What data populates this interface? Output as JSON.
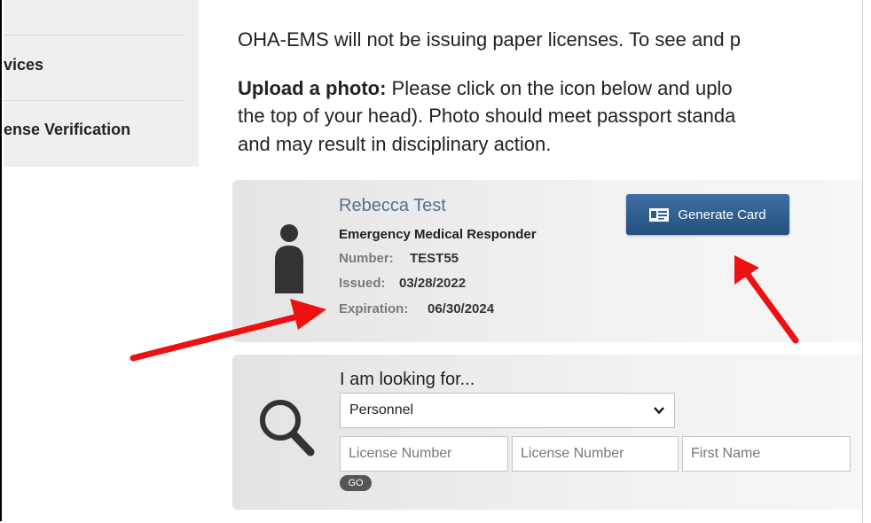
{
  "sidebar": {
    "items": [
      {
        "label": "vices"
      },
      {
        "label": "ense Verification"
      }
    ]
  },
  "main": {
    "intro": "OHA-EMS will not be issuing paper licenses. To see and p",
    "upload_bold": "Upload a photo:",
    "upload_line1": " Please click on the icon below and uplo",
    "upload_line2": "the top of your head). Photo should meet passport standa",
    "upload_line3": "and may result in disciplinary action."
  },
  "license": {
    "name": "Rebecca Test",
    "certification": "Emergency Medical Responder",
    "number_label": "Number:",
    "number_value": "TEST55",
    "issued_label": "Issued:",
    "issued_value": "03/28/2022",
    "expiration_label": "Expiration:",
    "expiration_value": "06/30/2024",
    "generate_button": "Generate Card"
  },
  "search": {
    "looking_label": "I am looking for...",
    "selected_type": "Personnel",
    "field1_placeholder": "License Number",
    "field2_placeholder": "License Number",
    "field3_placeholder": "First Name",
    "go_label": "GO"
  },
  "colors": {
    "arrow": "#ee1111",
    "button": "#2c5d8f",
    "name": "#5a6f8a"
  },
  "icons": [
    "person-icon",
    "id-card-icon",
    "search-icon",
    "chevron-down-icon",
    "red-arrow"
  ]
}
